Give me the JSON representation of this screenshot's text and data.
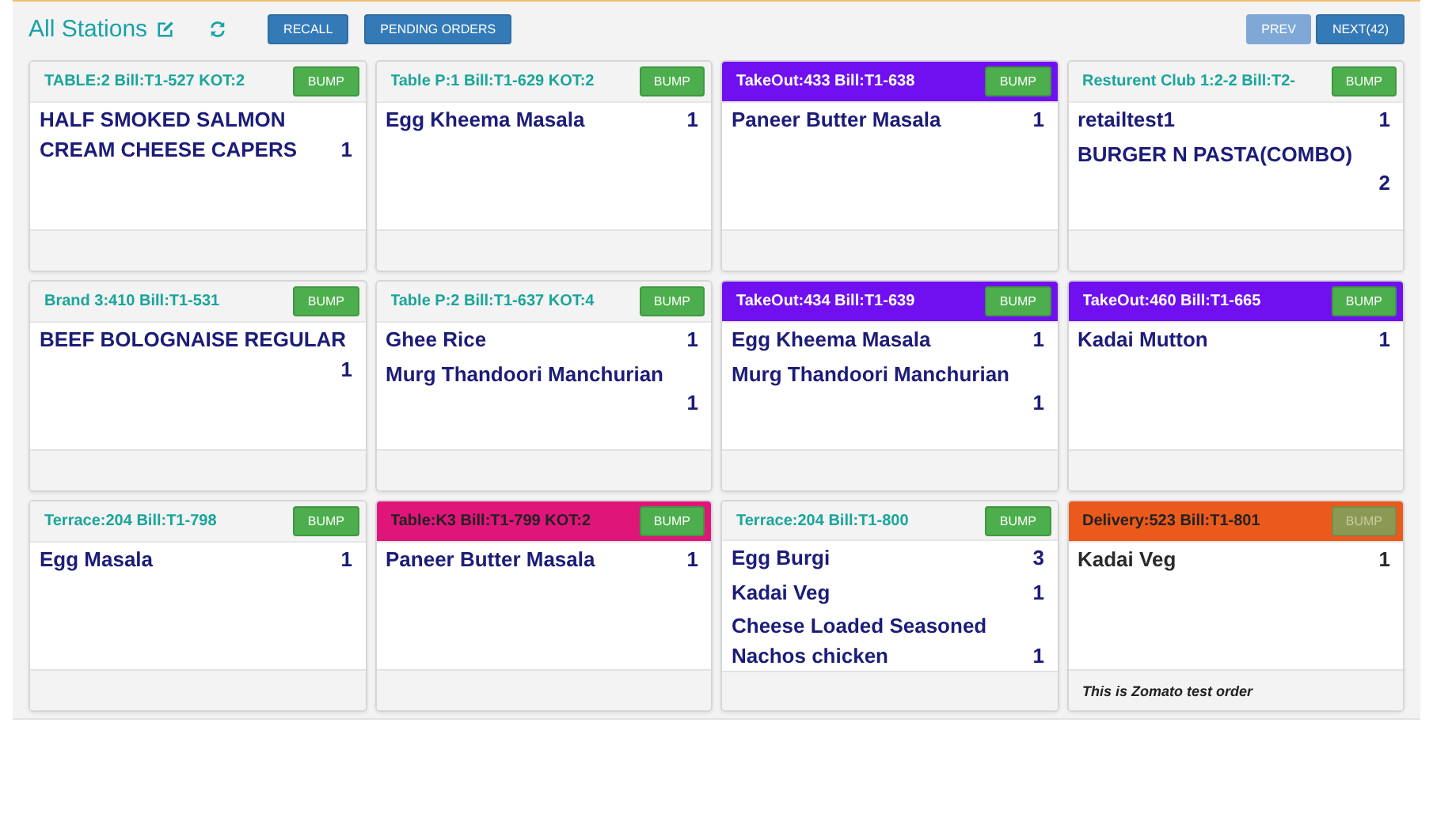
{
  "toolbar": {
    "title": "All Stations",
    "buttons": [
      "RECALL",
      "PENDING ORDERS"
    ],
    "pager": [
      {
        "label": "PREV",
        "disabled": true
      },
      {
        "label": "NEXT(42)",
        "disabled": false
      }
    ]
  },
  "orders": [
    {
      "kind": "dine-in",
      "header": "TABLE:2  Bill:T1-527  KOT:2",
      "bump": "BUMP",
      "disabled": false,
      "items": [
        {
          "name": "HALF SMOKED SALMON CREAM CHEESE CAPERS",
          "qty": "1"
        }
      ]
    },
    {
      "kind": "dine-in",
      "header": "Table P:1  Bill:T1-629  KOT:2",
      "bump": "BUMP",
      "disabled": false,
      "items": [
        {
          "name": "Egg Kheema Masala",
          "qty": "1"
        }
      ]
    },
    {
      "kind": "takeout",
      "header": "TakeOut:433  Bill:T1-638",
      "bump": "BUMP",
      "disabled": false,
      "items": [
        {
          "name": "Paneer Butter Masala",
          "qty": "1"
        }
      ]
    },
    {
      "kind": "dine-in",
      "header": "Resturent Club 1:2-2  Bill:T2-",
      "bump": "BUMP",
      "disabled": false,
      "items": [
        {
          "name": "retailtest1",
          "qty": "1"
        },
        {
          "name": "BURGER N PASTA(COMBO)",
          "qty": "2",
          "wrap": true
        }
      ]
    },
    {
      "kind": "dine-in",
      "header": "Brand 3:410  Bill:T1-531",
      "bump": "BUMP",
      "disabled": false,
      "items": [
        {
          "name": "BEEF BOLOGNAISE REGULAR",
          "qty": "1",
          "wrap": true
        }
      ]
    },
    {
      "kind": "dine-in",
      "header": "Table P:2  Bill:T1-637  KOT:4",
      "bump": "BUMP",
      "disabled": false,
      "items": [
        {
          "name": "Ghee Rice",
          "qty": "1"
        },
        {
          "name": "Murg Thandoori Manchurian",
          "qty": "1",
          "wrap": true
        }
      ]
    },
    {
      "kind": "takeout",
      "header": "TakeOut:434  Bill:T1-639",
      "bump": "BUMP",
      "disabled": false,
      "items": [
        {
          "name": "Egg Kheema Masala",
          "qty": "1"
        },
        {
          "name": "Murg Thandoori Manchurian",
          "qty": "1",
          "wrap": true
        }
      ]
    },
    {
      "kind": "takeout",
      "header": "TakeOut:460  Bill:T1-665",
      "bump": "BUMP",
      "disabled": false,
      "items": [
        {
          "name": "Kadai Mutton",
          "qty": "1"
        }
      ]
    },
    {
      "kind": "dine-in",
      "header": "Terrace:204  Bill:T1-798",
      "bump": "BUMP",
      "disabled": false,
      "items": [
        {
          "name": "Egg Masala",
          "qty": "1"
        }
      ]
    },
    {
      "kind": "table",
      "header": "Table:K3  Bill:T1-799  KOT:2",
      "bump": "BUMP",
      "disabled": false,
      "items": [
        {
          "name": "Paneer Butter Masala",
          "qty": "1"
        }
      ]
    },
    {
      "kind": "dine-in",
      "header": "Terrace:204  Bill:T1-800",
      "bump": "BUMP",
      "disabled": false,
      "items": [
        {
          "name": "Egg Burgi",
          "qty": "3"
        },
        {
          "name": "Kadai Veg",
          "qty": "1"
        },
        {
          "name": "Cheese Loaded Seasoned Nachos chicken",
          "qty": "1"
        }
      ]
    },
    {
      "kind": "delivery",
      "header": "Delivery:523  Bill:T1-801",
      "bump": "BUMP",
      "disabled": true,
      "items": [
        {
          "name": "Kadai Veg",
          "qty": "1"
        }
      ],
      "note": "This is Zomato test order"
    }
  ]
}
